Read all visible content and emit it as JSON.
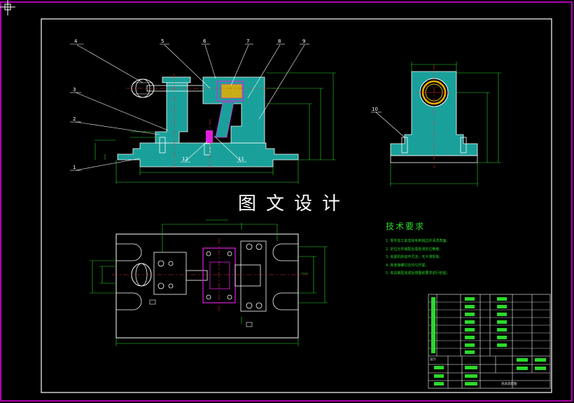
{
  "window": {
    "frame_color": "#b000b0"
  },
  "colors": {
    "background": "#000000",
    "outline": "#ffffff",
    "section_fill": "#1aa09a",
    "dimension": "#2bd92b",
    "center_line": "#e03030",
    "highlight": "#e020e0",
    "bushing": "#e8b000"
  },
  "watermark": "图文设计",
  "technical_requirements": {
    "title": "技术要求",
    "items": [
      "1. 零件加工前去除毛刺锐边并清洗表面。",
      "2. 定位元件装配后需检测定位精度。",
      "3. 夹紧机构动作灵活，无卡滞现象。",
      "4. 各连接螺钉应均匀拧紧。",
      "5. 夹具装配完成后按图纸要求进行检验。"
    ]
  },
  "part_callouts": [
    "1",
    "2",
    "3",
    "4",
    "5",
    "6",
    "7",
    "8",
    "9",
    "10",
    "11",
    "12"
  ],
  "title_block": {
    "drawing_title": "夹具装配图",
    "rows": [
      "设计",
      "审核",
      "工艺",
      "批准"
    ]
  },
  "icons": [
    "crosshair-icon"
  ]
}
